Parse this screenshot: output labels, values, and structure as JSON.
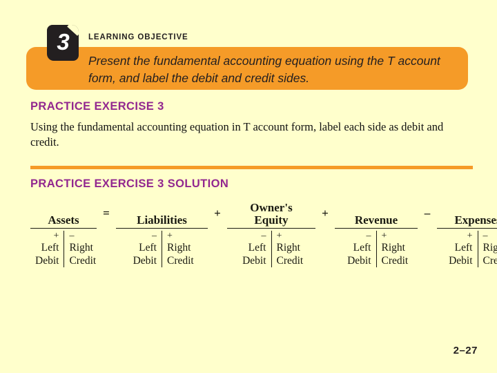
{
  "slide": {
    "background_color": "#FFFFCC",
    "page_number": "2–27"
  },
  "learning_objective": {
    "number": "3",
    "label": "LEARNING OBJECTIVE",
    "text": "Present the fundamental accounting equation using the T account form, and label the debit and credit sides.",
    "banner_color": "#F59B28",
    "badge_color": "#231F20"
  },
  "practice_exercise": {
    "heading": "PRACTICE EXERCISE 3",
    "body": "Using the fundamental accounting equation in T account form, label each side as debit and credit.",
    "heading_color": "#92278F"
  },
  "divider": {
    "color": "#F59B28"
  },
  "solution": {
    "heading": "PRACTICE EXERCISE 3 SOLUTION",
    "equation": {
      "operators": [
        "=",
        "+",
        "+",
        "–"
      ],
      "accounts": [
        {
          "title": "Assets",
          "left": {
            "sign": "+",
            "line1": "Left",
            "line2": "Debit"
          },
          "right": {
            "sign": "–",
            "line1": "Right",
            "line2": "Credit"
          }
        },
        {
          "title": "Liabilities",
          "left": {
            "sign": "–",
            "line1": "Left",
            "line2": "Debit"
          },
          "right": {
            "sign": "+",
            "line1": "Right",
            "line2": "Credit"
          }
        },
        {
          "title": "Owner's\nEquity",
          "left": {
            "sign": "–",
            "line1": "Left",
            "line2": "Debit"
          },
          "right": {
            "sign": "+",
            "line1": "Right",
            "line2": "Credit"
          }
        },
        {
          "title": "Revenue",
          "left": {
            "sign": "–",
            "line1": "Left",
            "line2": "Debit"
          },
          "right": {
            "sign": "+",
            "line1": "Right",
            "line2": "Credit"
          }
        },
        {
          "title": "Expenses",
          "left": {
            "sign": "+",
            "line1": "Left",
            "line2": "Debit"
          },
          "right": {
            "sign": "–",
            "line1": "Right",
            "line2": "Credit"
          }
        }
      ]
    }
  }
}
